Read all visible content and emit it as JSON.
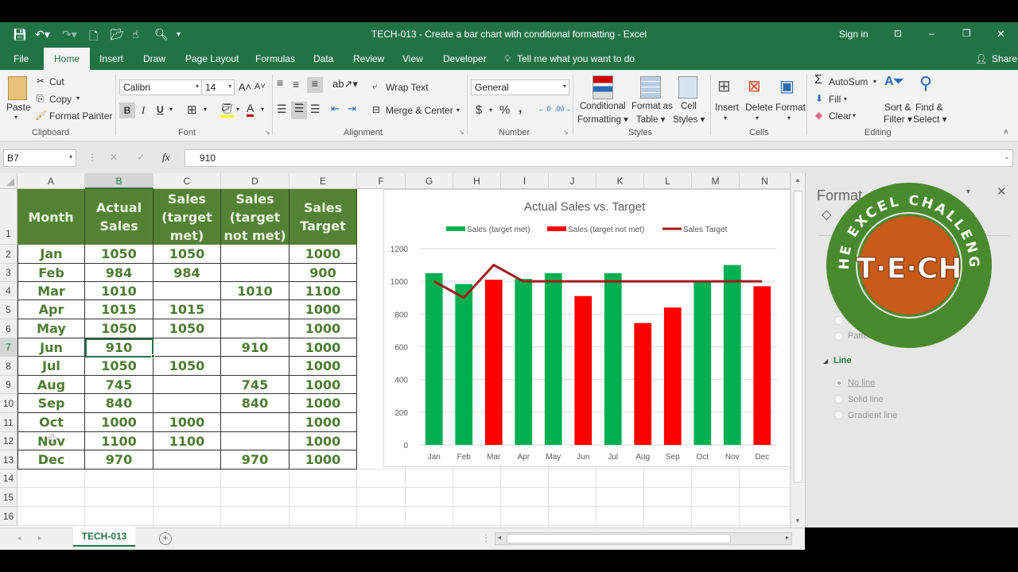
{
  "window": {
    "title": "TECH-013 - Create a bar chart with conditional formatting  -  Excel",
    "sign_in": "Sign in",
    "minimize": "–",
    "restore": "❐",
    "close": "✕"
  },
  "quick_access": [
    "save-icon",
    "undo-icon",
    "redo-icon",
    "new-icon",
    "open-icon",
    "touch-icon",
    "print-preview-icon",
    "customize-icon"
  ],
  "tabs": [
    "File",
    "Home",
    "Insert",
    "Draw",
    "Page Layout",
    "Formulas",
    "Data",
    "Review",
    "View",
    "Developer"
  ],
  "active_tab": "Home",
  "tell_me": "Tell me what you want to do",
  "share": "Share",
  "ribbon": {
    "clipboard": {
      "paste": "Paste",
      "cut": "Cut",
      "copy": "Copy",
      "format_painter": "Format Painter",
      "label": "Clipboard"
    },
    "font": {
      "name": "Calibri",
      "size": "14",
      "bold": "B",
      "italic": "I",
      "underline": "U",
      "label": "Font"
    },
    "alignment": {
      "wrap_text": "Wrap Text",
      "merge_center": "Merge & Center",
      "label": "Alignment"
    },
    "number": {
      "format": "General",
      "currency": "$",
      "percent": "%",
      "comma": ",",
      "label": "Number"
    },
    "styles": {
      "conditional_formatting": "Conditional",
      "conditional_formatting2": "Formatting ▾",
      "format_as_table": "Format as",
      "format_as_table2": "Table ▾",
      "cell_styles": "Cell",
      "cell_styles2": "Styles ▾",
      "label": "Styles"
    },
    "cells": {
      "insert": "Insert",
      "delete": "Delete",
      "format": "Format",
      "label": "Cells"
    },
    "editing": {
      "autosum": "AutoSum",
      "fill": "Fill",
      "clear": "Clear",
      "sort_filter": "Sort &",
      "sort_filter2": "Filter ▾",
      "find_select": "Find &",
      "find_select2": "Select ▾",
      "label": "Editing"
    }
  },
  "formula_bar": {
    "name_box": "B7",
    "cancel": "✕",
    "enter": "✓",
    "fx": "fx",
    "value": "910"
  },
  "columns": [
    "A",
    "B",
    "C",
    "D",
    "E",
    "F",
    "G",
    "H",
    "I",
    "J",
    "K",
    "L",
    "M",
    "N"
  ],
  "selected_column": "B",
  "rows": [
    "1",
    "2",
    "3",
    "4",
    "5",
    "6",
    "7",
    "8",
    "9",
    "10",
    "11",
    "12",
    "13",
    "14",
    "15",
    "16"
  ],
  "selected_row": "7",
  "table": {
    "headers": [
      [
        "Month"
      ],
      [
        "Actual",
        "Sales"
      ],
      [
        "Sales",
        "(target",
        "met)"
      ],
      [
        "Sales",
        "(target",
        "not met)"
      ],
      [
        "Sales",
        "Target"
      ]
    ],
    "rows": [
      [
        "Jan",
        "1050",
        "1050",
        "",
        "1000"
      ],
      [
        "Feb",
        "984",
        "984",
        "",
        "900"
      ],
      [
        "Mar",
        "1010",
        "",
        "1010",
        "1100"
      ],
      [
        "Apr",
        "1015",
        "1015",
        "",
        "1000"
      ],
      [
        "May",
        "1050",
        "1050",
        "",
        "1000"
      ],
      [
        "Jun",
        "910",
        "",
        "910",
        "1000"
      ],
      [
        "Jul",
        "1050",
        "1050",
        "",
        "1000"
      ],
      [
        "Aug",
        "745",
        "",
        "745",
        "1000"
      ],
      [
        "Sep",
        "840",
        "",
        "840",
        "1000"
      ],
      [
        "Oct",
        "1000",
        "1000",
        "",
        "1000"
      ],
      [
        "Nov",
        "1100",
        "1100",
        "",
        "1000"
      ],
      [
        "Dec",
        "970",
        "",
        "970",
        "1000"
      ]
    ]
  },
  "chart_data": {
    "type": "bar",
    "title": "Actual Sales vs. Target",
    "categories": [
      "Jan",
      "Feb",
      "Mar",
      "Apr",
      "May",
      "Jun",
      "Jul",
      "Aug",
      "Sep",
      "Oct",
      "Nov",
      "Dec"
    ],
    "series": [
      {
        "name": "Sales (target met)",
        "kind": "bar",
        "color": "#00b050",
        "values": [
          1050,
          984,
          null,
          1015,
          1050,
          null,
          1050,
          null,
          null,
          1000,
          1100,
          null
        ]
      },
      {
        "name": "Sales (target not met)",
        "kind": "bar",
        "color": "#ff0000",
        "values": [
          null,
          null,
          1010,
          null,
          null,
          910,
          null,
          745,
          840,
          null,
          null,
          970
        ]
      },
      {
        "name": "Sales Target",
        "kind": "line",
        "color": "#a01c1c",
        "values": [
          1000,
          900,
          1100,
          1000,
          1000,
          1000,
          1000,
          1000,
          1000,
          1000,
          1000,
          1000
        ]
      }
    ],
    "yticks": [
      "0",
      "200",
      "400",
      "600",
      "800",
      "1000",
      "1200"
    ],
    "ylim": [
      0,
      1200
    ],
    "legend": "top",
    "grid": true,
    "xlabel": "",
    "ylabel": ""
  },
  "format_pane": {
    "title": "Format",
    "fill_options": [
      "P..",
      "Pattern"
    ],
    "line_section": "Line",
    "line_options": [
      "No line",
      "Solid line",
      "Gradient line"
    ],
    "selected_line_option": "No line"
  },
  "logo": {
    "ring_text": "THE EXCEL CHALLENGE",
    "center_text": "T·E·CH",
    "ring_color": "#4a8a2e",
    "center_color": "#c85a1a"
  },
  "sheet_tabs": [
    "TECH-013"
  ],
  "add_sheet": "+"
}
